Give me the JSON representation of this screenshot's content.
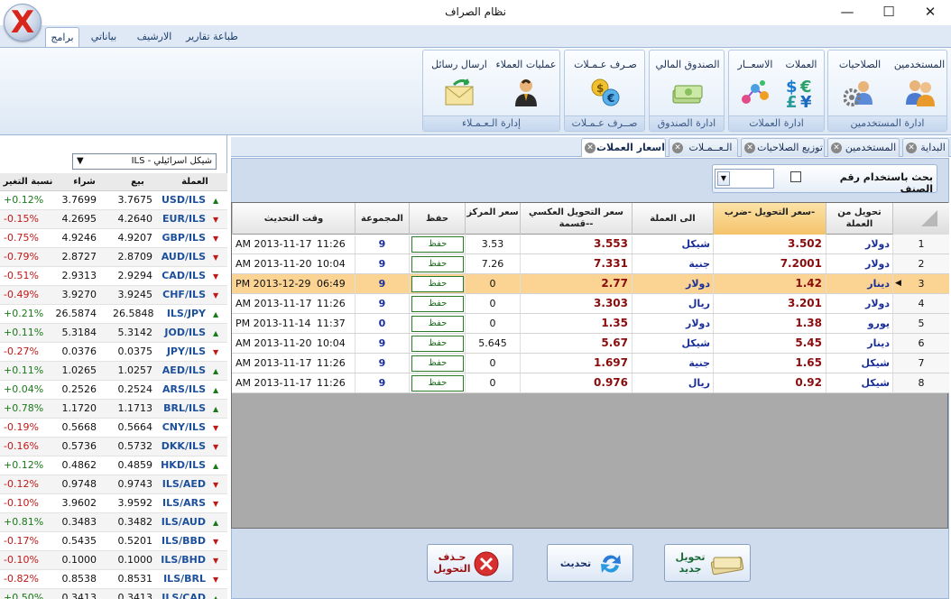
{
  "window": {
    "title": "نظام الصراف",
    "minimize": "—",
    "maximize": "☐",
    "close": "✕"
  },
  "logo": {
    "glyph": "X"
  },
  "ribbon_tabs": [
    "برامج",
    "بياناتي",
    "الارشيف",
    "طباعة تقارير"
  ],
  "ribbon_groups": {
    "users": {
      "label": "ادارة المستخدمين",
      "buttons": [
        "المستخدمين",
        "الصلاحيات"
      ]
    },
    "currencies": {
      "label": "ادارة العملات",
      "buttons": [
        "العملات",
        "الاسعــار"
      ]
    },
    "fund": {
      "label": "ادارة الصندوق",
      "buttons": [
        "الصندوق المالي"
      ]
    },
    "exchange": {
      "label": "صــرف عـمـلات",
      "buttons": [
        "صـرف عـمـلات"
      ]
    },
    "clients": {
      "label": "إدارة الـعـمـلاء",
      "buttons": [
        "عمليات العملاء",
        "ارسال رسائل"
      ]
    }
  },
  "currency_select": {
    "value": "ILS - شيكل اسرائيلي"
  },
  "rates_table": {
    "headers": {
      "currency": "العملة",
      "sell": "بيع",
      "buy": "شراء",
      "change": "نسبة التغير"
    },
    "rows": [
      {
        "dir": "up",
        "code": "USD/ILS",
        "sell": "3.7675",
        "buy": "3.7699",
        "change": "+0.12%"
      },
      {
        "dir": "down",
        "code": "EUR/ILS",
        "sell": "4.2640",
        "buy": "4.2695",
        "change": "-0.15%"
      },
      {
        "dir": "down",
        "code": "GBP/ILS",
        "sell": "4.9207",
        "buy": "4.9246",
        "change": "-0.75%"
      },
      {
        "dir": "down",
        "code": "AUD/ILS",
        "sell": "2.8709",
        "buy": "2.8727",
        "change": "-0.79%"
      },
      {
        "dir": "down",
        "code": "CAD/ILS",
        "sell": "2.9294",
        "buy": "2.9313",
        "change": "-0.51%"
      },
      {
        "dir": "down",
        "code": "CHF/ILS",
        "sell": "3.9245",
        "buy": "3.9270",
        "change": "-0.49%"
      },
      {
        "dir": "up",
        "code": "ILS/JPY",
        "sell": "26.5848",
        "buy": "26.5874",
        "change": "+0.21%"
      },
      {
        "dir": "up",
        "code": "JOD/ILS",
        "sell": "5.3142",
        "buy": "5.3184",
        "change": "+0.11%"
      },
      {
        "dir": "down",
        "code": "JPY/ILS",
        "sell": "0.0375",
        "buy": "0.0376",
        "change": "-0.27%"
      },
      {
        "dir": "up",
        "code": "AED/ILS",
        "sell": "1.0257",
        "buy": "1.0265",
        "change": "+0.11%"
      },
      {
        "dir": "up",
        "code": "ARS/ILS",
        "sell": "0.2524",
        "buy": "0.2526",
        "change": "+0.04%"
      },
      {
        "dir": "up",
        "code": "BRL/ILS",
        "sell": "1.1713",
        "buy": "1.1720",
        "change": "+0.78%"
      },
      {
        "dir": "down",
        "code": "CNY/ILS",
        "sell": "0.5664",
        "buy": "0.5668",
        "change": "-0.19%"
      },
      {
        "dir": "down",
        "code": "DKK/ILS",
        "sell": "0.5732",
        "buy": "0.5736",
        "change": "-0.16%"
      },
      {
        "dir": "up",
        "code": "HKD/ILS",
        "sell": "0.4859",
        "buy": "0.4862",
        "change": "+0.12%"
      },
      {
        "dir": "down",
        "code": "ILS/AED",
        "sell": "0.9743",
        "buy": "0.9748",
        "change": "-0.12%"
      },
      {
        "dir": "down",
        "code": "ILS/ARS",
        "sell": "3.9592",
        "buy": "3.9602",
        "change": "-0.10%"
      },
      {
        "dir": "up",
        "code": "ILS/AUD",
        "sell": "0.3482",
        "buy": "0.3483",
        "change": "+0.81%"
      },
      {
        "dir": "down",
        "code": "ILS/BBD",
        "sell": "0.5201",
        "buy": "0.5435",
        "change": "-0.17%"
      },
      {
        "dir": "down",
        "code": "ILS/BHD",
        "sell": "0.1000",
        "buy": "0.1000",
        "change": "-0.10%"
      },
      {
        "dir": "down",
        "code": "ILS/BRL",
        "sell": "0.8531",
        "buy": "0.8538",
        "change": "-0.82%"
      },
      {
        "dir": "up",
        "code": "ILS/CAD",
        "sell": "0.3413",
        "buy": "0.3413",
        "change": "+0.50%"
      }
    ]
  },
  "doc_tabs": [
    "البداية",
    "المستخدمين",
    "توزيع الصلاحيات",
    "الـعــمـلات",
    "اسعار العملات"
  ],
  "search": {
    "checkbox_label": "بحث باستخدام رقم الصنف",
    "value": ""
  },
  "grid": {
    "headers": {
      "from": "تحويل من العملة",
      "rate": "سعر التحويل -ضرب-",
      "to": "الى العملة",
      "inverse": "سعر التحويل العكسي -قسمة-",
      "center": "سعر المركز",
      "save": "حفظ",
      "group": "المجموعة",
      "updated": "وقت التحديث"
    },
    "rows": [
      {
        "n": "1",
        "from": "دولار",
        "rate": "3.502",
        "to": "شيكل",
        "inverse": "3.553",
        "center": "3.53",
        "save": "حفظ",
        "group": "9",
        "time": "11:26",
        "date": "AM 2013-11-17"
      },
      {
        "n": "2",
        "from": "دولار",
        "rate": "7.2001",
        "to": "جنية",
        "inverse": "7.331",
        "center": "7.26",
        "save": "حفظ",
        "group": "9",
        "time": "10:04",
        "date": "AM 2013-11-20"
      },
      {
        "n": "3",
        "from": "دينار",
        "rate": "1.42",
        "to": "دولار",
        "inverse": "2.77",
        "center": "0",
        "save": "حفظ",
        "group": "9",
        "time": "06:49",
        "date": "PM 2013-12-29"
      },
      {
        "n": "4",
        "from": "دولار",
        "rate": "3.201",
        "to": "ريال",
        "inverse": "3.303",
        "center": "0",
        "save": "حفظ",
        "group": "9",
        "time": "11:26",
        "date": "AM 2013-11-17"
      },
      {
        "n": "5",
        "from": "يورو",
        "rate": "1.38",
        "to": "دولار",
        "inverse": "1.35",
        "center": "0",
        "save": "حفظ",
        "group": "0",
        "time": "11:37",
        "date": "PM 2013-11-14"
      },
      {
        "n": "6",
        "from": "دينار",
        "rate": "5.45",
        "to": "شيكل",
        "inverse": "5.67",
        "center": "5.645",
        "save": "حفظ",
        "group": "9",
        "time": "10:04",
        "date": "AM 2013-11-20"
      },
      {
        "n": "7",
        "from": "شيكل",
        "rate": "1.65",
        "to": "جنية",
        "inverse": "1.697",
        "center": "0",
        "save": "حفظ",
        "group": "9",
        "time": "11:26",
        "date": "AM 2013-11-17"
      },
      {
        "n": "8",
        "from": "شيكل",
        "rate": "0.92",
        "to": "ريال",
        "inverse": "0.976",
        "center": "0",
        "save": "حفظ",
        "group": "9",
        "time": "11:26",
        "date": "AM 2013-11-17"
      }
    ],
    "selected_row": "3"
  },
  "bottom_buttons": {
    "new": "تحويل جديد",
    "refresh": "تحديث",
    "delete": "حـذف التحويل"
  },
  "colors": {
    "accent": "#1a2e9a",
    "selected_row": "#fbd494",
    "positive": "#1a7a1a",
    "negative": "#c01818"
  }
}
